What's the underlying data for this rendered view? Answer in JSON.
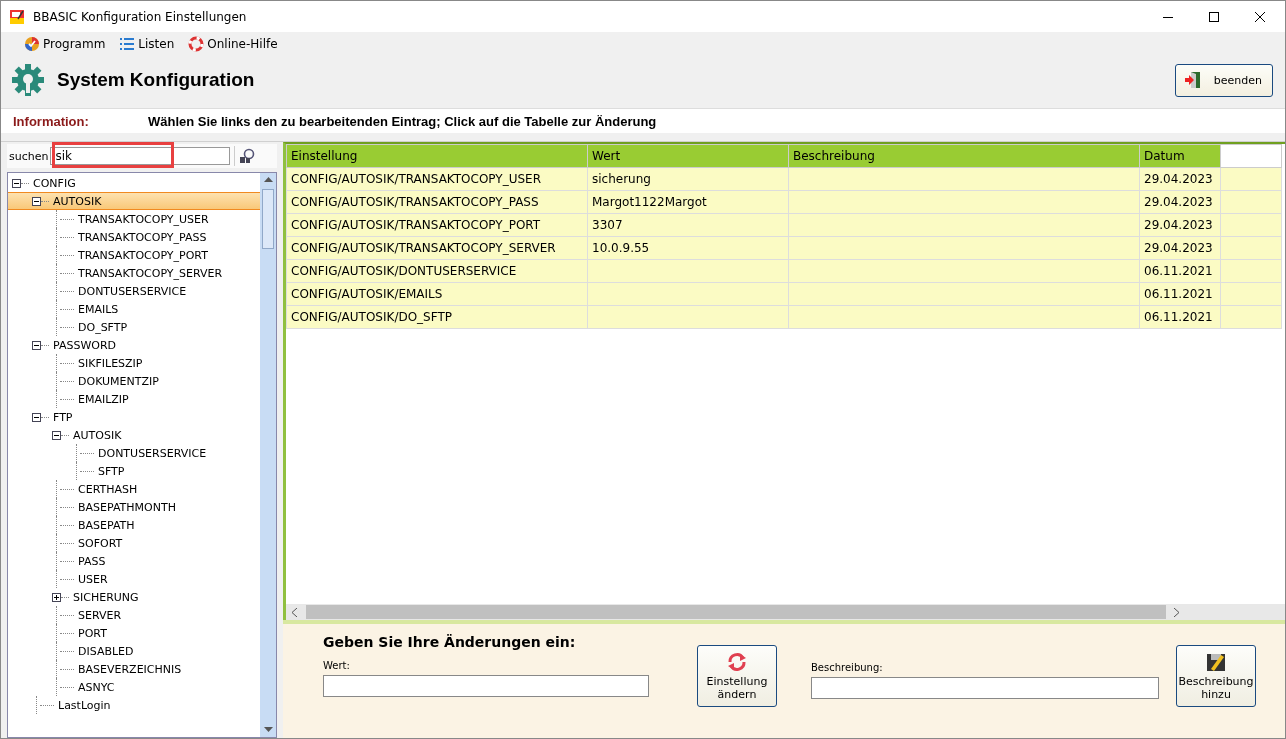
{
  "window": {
    "title": "BBASIC Konfiguration Einstellungen"
  },
  "menu": [
    {
      "label": "Programm",
      "kind": "program"
    },
    {
      "label": "Listen",
      "kind": "list"
    },
    {
      "label": "Online-Hilfe",
      "kind": "help"
    }
  ],
  "header": {
    "title": "System Konfiguration",
    "button": "beenden"
  },
  "info": {
    "label": "Information:",
    "text": "Wählen Sie links den zu bearbeitenden Eintrag; Click auf die Tabelle zur Änderung"
  },
  "search": {
    "label": "suchen",
    "value": "sik"
  },
  "tree": [
    {
      "label": "CONFIG",
      "expanded": true,
      "selected": false,
      "children": [
        {
          "label": "AUTOSIK",
          "expanded": true,
          "selected": true,
          "children": [
            {
              "label": "TRANSAKTOCOPY_USER",
              "selected": false
            },
            {
              "label": "TRANSAKTOCOPY_PASS",
              "selected": false
            },
            {
              "label": "TRANSAKTOCOPY_PORT",
              "selected": false
            },
            {
              "label": "TRANSAKTOCOPY_SERVER",
              "selected": false
            },
            {
              "label": "DONTUSERSERVICE",
              "selected": false
            },
            {
              "label": "EMAILS",
              "selected": false
            },
            {
              "label": "DO_SFTP",
              "selected": false
            }
          ]
        },
        {
          "label": "PASSWORD",
          "expanded": true,
          "selected": false,
          "children": [
            {
              "label": "SIKFILESZIP",
              "selected": false
            },
            {
              "label": "DOKUMENTZIP",
              "selected": false
            },
            {
              "label": "EMAILZIP",
              "selected": false
            }
          ]
        },
        {
          "label": "FTP",
          "expanded": true,
          "selected": false,
          "children": [
            {
              "label": "AUTOSIK",
              "expanded": true,
              "selected": false,
              "children": [
                {
                  "label": "DONTUSERSERVICE",
                  "selected": false
                },
                {
                  "label": "SFTP",
                  "selected": false
                }
              ]
            },
            {
              "label": "CERTHASH",
              "selected": false
            },
            {
              "label": "BASEPATHMONTH",
              "selected": false
            },
            {
              "label": "BASEPATH",
              "selected": false
            },
            {
              "label": "SOFORT",
              "selected": false
            },
            {
              "label": "PASS",
              "selected": false
            },
            {
              "label": "USER",
              "selected": false
            },
            {
              "label": "SICHERUNG",
              "expanded": false,
              "selected": false
            },
            {
              "label": "SERVER",
              "selected": false
            },
            {
              "label": "PORT",
              "selected": false
            },
            {
              "label": "DISABLED",
              "selected": false
            },
            {
              "label": "BASEVERZEICHNIS",
              "selected": false
            },
            {
              "label": "ASNYC",
              "selected": false
            }
          ]
        },
        {
          "label": "LastLogin",
          "selected": false
        }
      ]
    }
  ],
  "table": {
    "columns": [
      "Einstellung",
      "Wert",
      "Beschreibung",
      "Datum"
    ],
    "rows": [
      {
        "cells": [
          "CONFIG/AUTOSIK/TRANSAKTOCOPY_USER",
          "sicherung",
          "",
          "29.04.2023"
        ]
      },
      {
        "cells": [
          "CONFIG/AUTOSIK/TRANSAKTOCOPY_PASS",
          "Margot1122Margot",
          "",
          "29.04.2023"
        ]
      },
      {
        "cells": [
          "CONFIG/AUTOSIK/TRANSAKTOCOPY_PORT",
          "3307",
          "",
          "29.04.2023"
        ]
      },
      {
        "cells": [
          "CONFIG/AUTOSIK/TRANSAKTOCOPY_SERVER",
          "10.0.9.55",
          "",
          "29.04.2023"
        ]
      },
      {
        "cells": [
          "CONFIG/AUTOSIK/DONTUSERSERVICE",
          "",
          "",
          "06.11.2021"
        ]
      },
      {
        "cells": [
          "CONFIG/AUTOSIK/EMAILS",
          "",
          "",
          "06.11.2021"
        ]
      },
      {
        "cells": [
          "CONFIG/AUTOSIK/DO_SFTP",
          "",
          "",
          "06.11.2021"
        ]
      }
    ]
  },
  "form": {
    "heading": "Geben Sie Ihre Änderungen ein:",
    "value_label": "Wert:",
    "change_button": "Einstellung ändern",
    "description_label": "Beschreibung:",
    "add_button": "Beschreibung hinzu"
  }
}
